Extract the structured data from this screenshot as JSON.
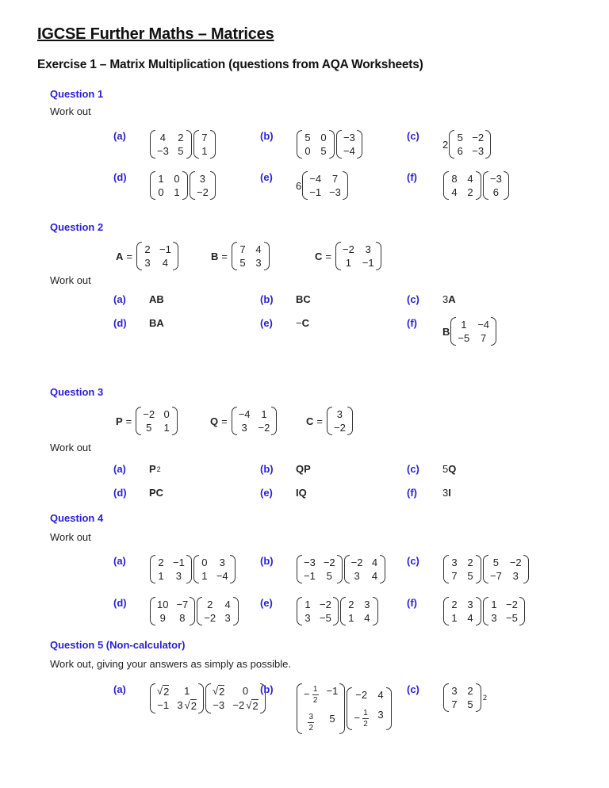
{
  "document": {
    "title": "IGCSE Further Maths – Matrices",
    "subtitle": "Exercise 1 – Matrix Multiplication (questions from AQA Worksheets)"
  },
  "questions": [
    {
      "heading": "Question 1",
      "instruction": "Work out",
      "parts": [
        {
          "label": "(a)",
          "expr": [
            {
              "m": [
                [
                  "4",
                  "2"
                ],
                [
                  "−3",
                  "5"
                ]
              ]
            },
            {
              "m": [
                [
                  "7"
                ],
                [
                  "1"
                ]
              ]
            }
          ]
        },
        {
          "label": "(b)",
          "expr": [
            {
              "m": [
                [
                  "5",
                  "0"
                ],
                [
                  "0",
                  "5"
                ]
              ]
            },
            {
              "m": [
                [
                  "−3"
                ],
                [
                  "−4"
                ]
              ]
            }
          ]
        },
        {
          "label": "(c)",
          "expr": [
            {
              "t": "2"
            },
            {
              "m": [
                [
                  "5",
                  "−2"
                ],
                [
                  "6",
                  "−3"
                ]
              ]
            }
          ]
        },
        {
          "label": "(d)",
          "expr": [
            {
              "m": [
                [
                  "1",
                  "0"
                ],
                [
                  "0",
                  "1"
                ]
              ]
            },
            {
              "m": [
                [
                  "3"
                ],
                [
                  "−2"
                ]
              ]
            }
          ]
        },
        {
          "label": "(e)",
          "expr": [
            {
              "t": "6"
            },
            {
              "m": [
                [
                  "−4",
                  "7"
                ],
                [
                  "−1",
                  "−3"
                ]
              ]
            }
          ]
        },
        {
          "label": "(f)",
          "expr": [
            {
              "m": [
                [
                  "8",
                  "4"
                ],
                [
                  "4",
                  "2"
                ]
              ]
            },
            {
              "m": [
                [
                  "−3"
                ],
                [
                  "6"
                ]
              ]
            }
          ]
        }
      ]
    },
    {
      "heading": "Question 2",
      "definitions": [
        {
          "name": "A",
          "m": [
            [
              "2",
              "−1"
            ],
            [
              "3",
              "4"
            ]
          ]
        },
        {
          "name": "B",
          "m": [
            [
              "7",
              "4"
            ],
            [
              "5",
              "3"
            ]
          ]
        },
        {
          "name": "C",
          "m": [
            [
              "−2",
              "3"
            ],
            [
              "1",
              "−1"
            ]
          ]
        }
      ],
      "instruction": "Work out",
      "parts": [
        {
          "label": "(a)",
          "expr": [
            {
              "b": "AB"
            }
          ]
        },
        {
          "label": "(b)",
          "expr": [
            {
              "b": "BC"
            }
          ]
        },
        {
          "label": "(c)",
          "expr": [
            {
              "t": "3"
            },
            {
              "b": "A"
            }
          ]
        },
        {
          "label": "(d)",
          "expr": [
            {
              "b": "BA"
            }
          ]
        },
        {
          "label": "(e)",
          "expr": [
            {
              "t": "−"
            },
            {
              "b": "C"
            }
          ]
        },
        {
          "label": "(f)",
          "expr": [
            {
              "b": "B"
            },
            {
              "m": [
                [
                  "1",
                  "−4"
                ],
                [
                  "−5",
                  "7"
                ]
              ]
            }
          ]
        }
      ]
    },
    {
      "heading": "Question 3",
      "definitions": [
        {
          "name": "P",
          "m": [
            [
              "−2",
              "0"
            ],
            [
              "5",
              "1"
            ]
          ]
        },
        {
          "name": "Q",
          "m": [
            [
              "−4",
              "1"
            ],
            [
              "3",
              "−2"
            ]
          ]
        },
        {
          "name": "C",
          "m": [
            [
              "3"
            ],
            [
              "−2"
            ]
          ]
        }
      ],
      "instruction": "Work out",
      "parts": [
        {
          "label": "(a)",
          "expr": [
            {
              "b": "P"
            },
            {
              "sup": "2"
            }
          ]
        },
        {
          "label": "(b)",
          "expr": [
            {
              "b": "QP"
            }
          ]
        },
        {
          "label": "(c)",
          "expr": [
            {
              "t": "5"
            },
            {
              "b": "Q"
            }
          ]
        },
        {
          "label": "(d)",
          "expr": [
            {
              "b": "PC"
            }
          ]
        },
        {
          "label": "(e)",
          "expr": [
            {
              "b": "IQ"
            }
          ]
        },
        {
          "label": "(f)",
          "expr": [
            {
              "t": "3"
            },
            {
              "b": "I"
            }
          ]
        }
      ]
    },
    {
      "heading": "Question 4",
      "instruction": "Work out",
      "parts": [
        {
          "label": "(a)",
          "expr": [
            {
              "m": [
                [
                  "2",
                  "−1"
                ],
                [
                  "1",
                  "3"
                ]
              ]
            },
            {
              "m": [
                [
                  "0",
                  "3"
                ],
                [
                  "1",
                  "−4"
                ]
              ]
            }
          ]
        },
        {
          "label": "(b)",
          "expr": [
            {
              "m": [
                [
                  "−3",
                  "−2"
                ],
                [
                  "−1",
                  "5"
                ]
              ]
            },
            {
              "m": [
                [
                  "−2",
                  "4"
                ],
                [
                  "3",
                  "4"
                ]
              ]
            }
          ]
        },
        {
          "label": "(c)",
          "expr": [
            {
              "m": [
                [
                  "3",
                  "2"
                ],
                [
                  "7",
                  "5"
                ]
              ]
            },
            {
              "m": [
                [
                  "5",
                  "−2"
                ],
                [
                  "−7",
                  "3"
                ]
              ]
            }
          ]
        },
        {
          "label": "(d)",
          "expr": [
            {
              "m": [
                [
                  "10",
                  "−7"
                ],
                [
                  "9",
                  "8"
                ]
              ]
            },
            {
              "m": [
                [
                  "2",
                  "4"
                ],
                [
                  "−2",
                  "3"
                ]
              ]
            }
          ]
        },
        {
          "label": "(e)",
          "expr": [
            {
              "m": [
                [
                  "1",
                  "−2"
                ],
                [
                  "3",
                  "−5"
                ]
              ]
            },
            {
              "m": [
                [
                  "2",
                  "3"
                ],
                [
                  "1",
                  "4"
                ]
              ]
            }
          ]
        },
        {
          "label": "(f)",
          "expr": [
            {
              "m": [
                [
                  "2",
                  "3"
                ],
                [
                  "1",
                  "4"
                ]
              ]
            },
            {
              "m": [
                [
                  "1",
                  "−2"
                ],
                [
                  "3",
                  "−5"
                ]
              ]
            }
          ]
        }
      ]
    },
    {
      "heading": "Question 5 (Non-calculator)",
      "instruction": "Work out, giving your answers as simply as possible.",
      "parts": [
        {
          "label": "(a)",
          "expr": [
            {
              "m": [
                [
                  "√2",
                  "1"
                ],
                [
                  "−1",
                  "3√2"
                ]
              ]
            },
            {
              "m": [
                [
                  "√2",
                  "0"
                ],
                [
                  "−3",
                  "−2√2"
                ]
              ]
            }
          ]
        },
        {
          "label": "(b)",
          "expr": [
            {
              "m": [
                [
                  "−1/2",
                  "−1"
                ],
                [
                  "3/2",
                  "5"
                ]
              ],
              "tall": true
            },
            {
              "m": [
                [
                  "−2",
                  "4"
                ],
                [
                  "−1/2",
                  "3"
                ]
              ],
              "tall": true
            }
          ]
        },
        {
          "label": "(c)",
          "expr": [
            {
              "m": [
                [
                  "3",
                  "2"
                ],
                [
                  "7",
                  "5"
                ]
              ]
            },
            {
              "sup": "2"
            }
          ]
        }
      ]
    }
  ]
}
